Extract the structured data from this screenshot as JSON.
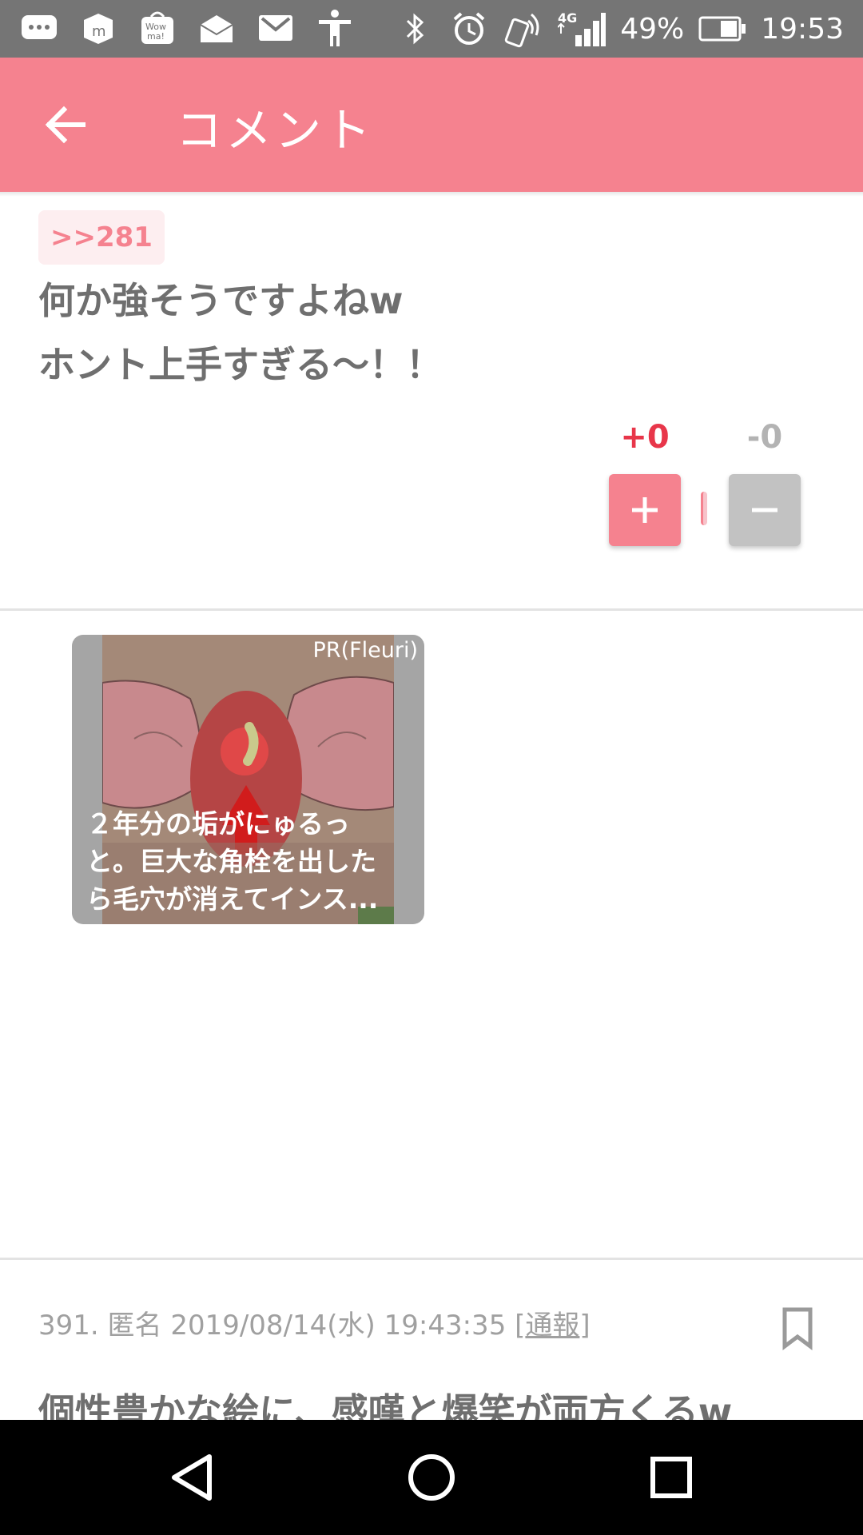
{
  "status_bar": {
    "battery_percent": "49%",
    "time": "19:53",
    "network": "4G",
    "icons_left": [
      "message-icon",
      "app-m-icon",
      "wowma-icon",
      "au-mail-icon",
      "gmail-icon",
      "accessibility-icon"
    ],
    "icons_right": [
      "bluetooth-icon",
      "alarm-icon",
      "nfc-icon",
      "signal-icon",
      "battery-icon"
    ]
  },
  "app_bar": {
    "title": "コメント"
  },
  "comment": {
    "reply_tag": ">>281",
    "line1": "何か強そうですよねw",
    "line2": "ホント上手すぎる〜！！",
    "plus_count": "+0",
    "minus_count": "-0"
  },
  "ad": {
    "pr_label": "PR(Fleuri)",
    "caption": "２年分の垢がにゅるっ\nと。巨大な角栓を出した\nら毛穴が消えてインス..."
  },
  "next_comment": {
    "meta_prefix": "391. 匿名 2019/08/14(水) 19:43:35 ",
    "bracket_open": "[",
    "report_label": "通報",
    "bracket_close": "]",
    "body": "個性豊かな絵に、感嘆と爆笑が両方くるw"
  },
  "colors": {
    "accent": "#f5828f",
    "plus_red": "#e8364a",
    "status_bar": "#757575",
    "text_gray": "#6f6f6f"
  }
}
